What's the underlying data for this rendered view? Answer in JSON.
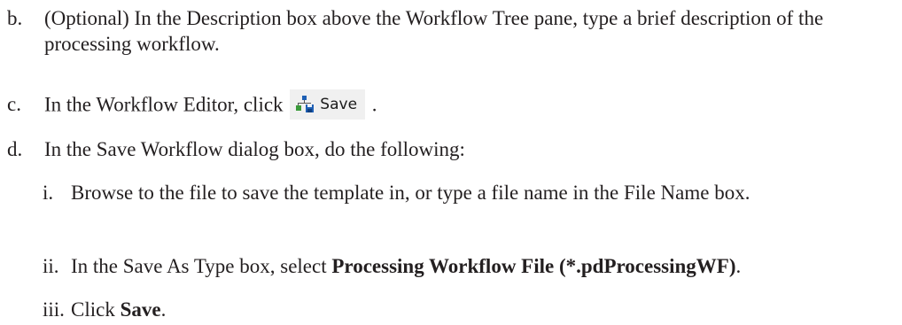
{
  "steps": [
    {
      "marker": "b.",
      "text": "(Optional) In the Description box above the Workflow Tree pane, type a brief description of the processing workflow."
    },
    {
      "marker": "c.",
      "text_before": "In the Workflow Editor, click",
      "button_label": "Save",
      "button_icon": "save-workflow-icon",
      "text_after": "."
    },
    {
      "marker": "d.",
      "text": "In the Save Workflow dialog box, do the following:",
      "substeps": [
        {
          "marker": "i.",
          "text": "Browse to the file to save the template in, or type a file name in the File Name box."
        },
        {
          "marker": "ii.",
          "text_before": "In the Save As Type box, select ",
          "bold": "Processing Workflow File (*.pdProcessingWF)",
          "text_after": "."
        },
        {
          "marker": "iii.",
          "text_before": "Click ",
          "bold": "Save",
          "text_after": "."
        }
      ]
    }
  ],
  "colors": {
    "text": "#231f20",
    "button_bg": "#f0f0f0",
    "icon_green": "#3a9a3a",
    "icon_blue": "#1e5fb4"
  }
}
